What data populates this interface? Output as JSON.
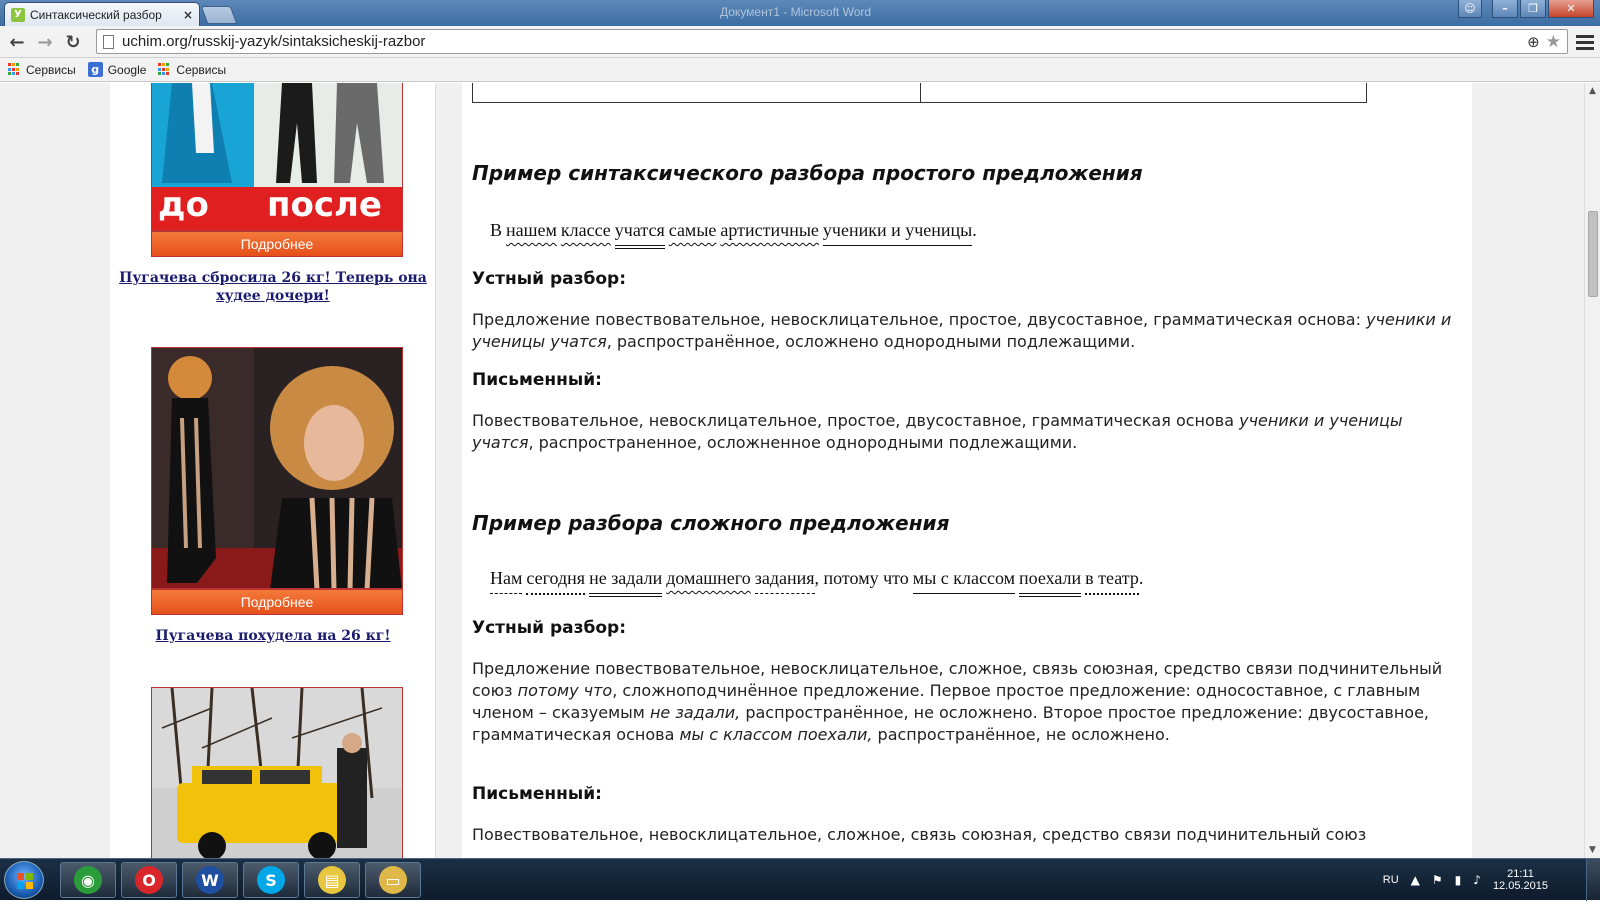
{
  "browser": {
    "tab_title": "Синтаксический разбор",
    "tab_favicon": "У",
    "tab_close": "×",
    "window_title": "Документ1 - Microsoft Word",
    "url": "uchim.org/russkij-yazyk/sintaksicheskij-razbor",
    "bookmarks": [
      {
        "label": "Сервисы",
        "icon": "apps-icon"
      },
      {
        "label": "Google",
        "icon": "google-icon"
      },
      {
        "label": "Сервисы",
        "icon": "apps-icon"
      }
    ]
  },
  "sidebar": {
    "ad1": {
      "before_label": "до",
      "after_label": "после",
      "button": "Подробнее",
      "caption": "Пугачева сбросила 26 кг! Теперь она худее дочери!"
    },
    "ad2": {
      "button": "Подробнее",
      "caption": "Пугачева похудела на 26 кг!"
    },
    "ad3": {}
  },
  "content": {
    "section1_title": "Пример синтаксического разбора простого предложения",
    "example1": {
      "w1": "В",
      "w2": "нашем",
      "w3": "классе",
      "w4": "учатся",
      "w5": "самые",
      "w6": "артистичные",
      "w7": "ученики и ученицы",
      "w8": "."
    },
    "oral1_heading": "Устный разбор:",
    "oral1_text_a": "Предложение повествовательное, невосклицательное, простое, двусоставное, грамматическая основа:",
    "oral1_text_em": "ученики и ученицы учатся",
    "oral1_text_b": ", распространённое, осложнено однородными подлежащими.",
    "written1_heading": "Письменный:",
    "written1_text_a": "Повествовательное, невосклицательное, простое, двусоставное, грамматическая основа",
    "written1_text_em": "ученики и ученицы учатся",
    "written1_text_b": ", распространенное, осложненное однородными подлежащими.",
    "section2_title": "Пример разбора сложного предложения",
    "example2": {
      "w1": "Нам",
      "w2": "сегодня",
      "w3": "не задали",
      "w4": "домашнего",
      "w5": "задания",
      "w6": ", потому что",
      "w7": "мы с классом",
      "w8": "поехали",
      "w9": "в театр",
      "w10": "."
    },
    "oral2_heading": "Устный разбор:",
    "oral2_text_a": "Предложение повествовательное, невосклицательное, сложное, связь союзная, средство связи подчинительный союз",
    "oral2_text_em1": "потому что",
    "oral2_text_b": ", сложноподчинённое предложение. Первое простое предложение: односоставное, с главным членом – сказуемым",
    "oral2_text_em2": "не задали,",
    "oral2_text_c": " распространённое, не осложнено. Второе простое предложение: двусоставное, грамматическая основа",
    "oral2_text_em3": "мы с классом поехали,",
    "oral2_text_d": " распространённое, не осложнено.",
    "written2_heading": "Письменный:",
    "written2_text": "Повествовательное, невосклицательное, сложное, связь союзная, средство связи подчинительный союз"
  },
  "taskbar": {
    "apps": [
      {
        "name": "chrome-icon",
        "glyph": "◉",
        "color": "#2a9d3a"
      },
      {
        "name": "opera-icon",
        "glyph": "O",
        "color": "#d9262b"
      },
      {
        "name": "word-icon",
        "glyph": "W",
        "color": "#1e4fa0"
      },
      {
        "name": "skype-icon",
        "glyph": "S",
        "color": "#00a8e8"
      },
      {
        "name": "notes-icon",
        "glyph": "▤",
        "color": "#e8c640"
      },
      {
        "name": "explorer-icon",
        "glyph": "▭",
        "color": "#e0b84a"
      }
    ],
    "lang": "RU",
    "time": "21:11",
    "date": "12.05.2015"
  },
  "colors": {
    "accent_orange": "#e5501a",
    "ad_border": "#bb3333",
    "link_blue": "#1a1a6e"
  }
}
